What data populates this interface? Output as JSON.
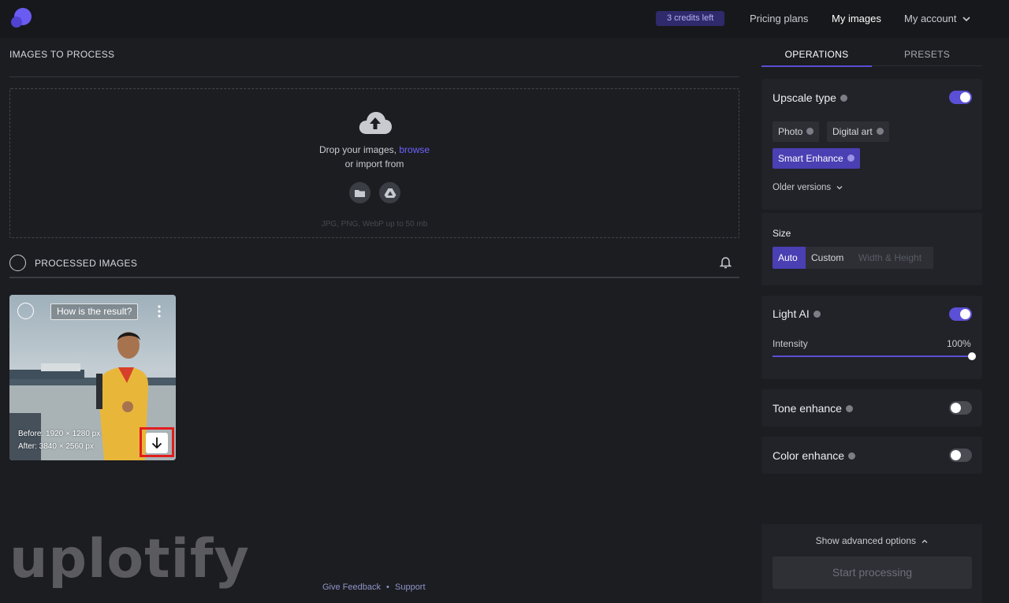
{
  "header": {
    "credits": "3 credits left",
    "nav": {
      "pricing": "Pricing plans",
      "images": "My images",
      "account": "My account"
    }
  },
  "left": {
    "images_to_process": "IMAGES TO PROCESS",
    "drop_text": "Drop your images,",
    "browse": "browse",
    "import_text": "or import from",
    "formats": "JPG, PNG, WebP up to 50 mb",
    "processed_title": "PROCESSED IMAGES",
    "card": {
      "result_tag": "How is the result?",
      "before": "Before: 1920 × 1280 px",
      "after": "After: 3840 × 2560 px"
    }
  },
  "watermark": "uplotify",
  "footer": {
    "feedback": "Give Feedback",
    "separator": "•",
    "support": "Support"
  },
  "right": {
    "tabs": {
      "operations": "OPERATIONS",
      "presets": "PRESETS"
    },
    "upscale": {
      "title": "Upscale type",
      "enabled": true,
      "options": [
        "Photo",
        "Digital art",
        "Smart Enhance"
      ],
      "selected": "Smart Enhance",
      "older": "Older versions"
    },
    "size": {
      "title": "Size",
      "options": [
        "Auto",
        "Custom",
        "Width & Height"
      ],
      "selected": "Auto"
    },
    "light_ai": {
      "title": "Light AI",
      "enabled": true,
      "intensity_label": "Intensity",
      "intensity_value": "100%",
      "intensity_fraction": 1.0
    },
    "tone": {
      "title": "Tone enhance",
      "enabled": false
    },
    "color": {
      "title": "Color enhance",
      "enabled": false
    },
    "advanced": "Show advanced options",
    "start": "Start processing"
  },
  "colors": {
    "accent": "#5b4fd6",
    "link": "#6c63ff",
    "highlight": "#e21d1d",
    "background": "#1c1d21"
  }
}
